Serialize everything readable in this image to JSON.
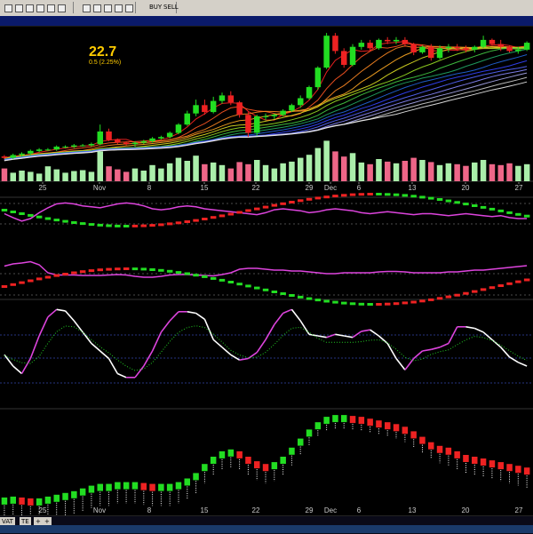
{
  "price": {
    "value": "22.7",
    "change": "0.5 (2.25%)"
  },
  "toolbar": {
    "icons": [
      "grid-icon",
      "pencil-icon",
      "undo-icon",
      "redo-icon",
      "crosshair-icon",
      "trendline-icon",
      "line-tool-icon",
      "zoom-icon",
      "magnet-icon",
      "buy-icon",
      "sell-icon"
    ],
    "buy_label": "BUY",
    "sell_label": "SELL"
  },
  "tabs": [
    "VAT",
    "TE",
    "+",
    "+"
  ],
  "colors": {
    "up": "#22dd22",
    "down": "#ee2222",
    "osc": "#dd44dd",
    "white": "#ffffff",
    "dots": "#22cc22",
    "grid": "#555555"
  },
  "chart_data": [
    {
      "type": "candlestick",
      "panel": "price",
      "x_tick_labels": [
        "25",
        "Nov",
        "8",
        "15",
        "22",
        "29",
        "Dec",
        "6",
        "13",
        "20",
        "27"
      ],
      "candles": [
        [
          14.5,
          14.6,
          14.3,
          14.4
        ],
        [
          14.4,
          14.7,
          14.3,
          14.6
        ],
        [
          14.6,
          14.8,
          14.5,
          14.7
        ],
        [
          14.7,
          15.0,
          14.6,
          14.9
        ],
        [
          14.9,
          15.1,
          14.8,
          15.0
        ],
        [
          15.0,
          15.1,
          14.9,
          15.0
        ],
        [
          15.0,
          15.3,
          14.9,
          15.2
        ],
        [
          15.2,
          15.3,
          15.1,
          15.2
        ],
        [
          15.2,
          15.4,
          15.1,
          15.3
        ],
        [
          15.3,
          15.4,
          15.2,
          15.3
        ],
        [
          15.3,
          15.5,
          15.2,
          15.4
        ],
        [
          15.4,
          16.8,
          15.3,
          16.3
        ],
        [
          16.3,
          16.5,
          15.6,
          15.7
        ],
        [
          15.7,
          15.8,
          15.4,
          15.5
        ],
        [
          15.5,
          15.6,
          15.3,
          15.4
        ],
        [
          15.4,
          15.6,
          15.2,
          15.5
        ],
        [
          15.5,
          15.7,
          15.4,
          15.6
        ],
        [
          15.6,
          15.9,
          15.5,
          15.8
        ],
        [
          15.8,
          16.0,
          15.7,
          15.9
        ],
        [
          15.9,
          16.3,
          15.8,
          16.2
        ],
        [
          16.2,
          16.9,
          16.1,
          16.8
        ],
        [
          16.8,
          17.8,
          16.7,
          17.6
        ],
        [
          17.6,
          18.6,
          17.4,
          18.2
        ],
        [
          18.2,
          18.6,
          17.5,
          17.7
        ],
        [
          17.7,
          18.8,
          17.6,
          18.5
        ],
        [
          18.5,
          19.1,
          18.3,
          18.9
        ],
        [
          18.9,
          19.2,
          18.2,
          18.4
        ],
        [
          18.4,
          18.5,
          17.3,
          17.5
        ],
        [
          17.5,
          17.7,
          15.9,
          16.2
        ],
        [
          16.2,
          17.5,
          16.0,
          17.4
        ],
        [
          17.4,
          17.6,
          17.1,
          17.4
        ],
        [
          17.4,
          17.6,
          17.2,
          17.5
        ],
        [
          17.5,
          17.9,
          17.4,
          17.8
        ],
        [
          17.8,
          18.3,
          17.7,
          18.2
        ],
        [
          18.2,
          18.9,
          18.0,
          18.7
        ],
        [
          18.7,
          19.6,
          18.6,
          19.5
        ],
        [
          19.5,
          21.0,
          19.3,
          20.9
        ],
        [
          20.9,
          23.4,
          20.8,
          23.2
        ],
        [
          23.2,
          23.4,
          21.9,
          22.1
        ],
        [
          22.1,
          22.3,
          20.9,
          21.1
        ],
        [
          21.1,
          22.6,
          21.0,
          22.4
        ],
        [
          22.4,
          22.9,
          22.2,
          22.7
        ],
        [
          22.7,
          22.9,
          22.1,
          22.3
        ],
        [
          22.3,
          23.0,
          22.2,
          22.9
        ],
        [
          22.9,
          23.1,
          22.6,
          22.8
        ],
        [
          22.8,
          23.1,
          22.6,
          22.9
        ],
        [
          22.9,
          23.1,
          22.4,
          22.6
        ],
        [
          22.6,
          22.7,
          21.8,
          22.0
        ],
        [
          22.0,
          22.5,
          21.9,
          22.4
        ],
        [
          22.4,
          22.6,
          21.4,
          21.6
        ],
        [
          21.6,
          22.5,
          21.5,
          22.3
        ],
        [
          22.3,
          22.6,
          22.0,
          22.4
        ],
        [
          22.4,
          22.6,
          22.1,
          22.3
        ],
        [
          22.3,
          22.5,
          22.0,
          22.2
        ],
        [
          22.2,
          22.5,
          22.0,
          22.4
        ],
        [
          22.4,
          23.2,
          22.3,
          22.9
        ],
        [
          22.9,
          23.0,
          22.5,
          22.6
        ],
        [
          22.6,
          22.9,
          22.1,
          22.4
        ],
        [
          22.4,
          22.5,
          22.0,
          22.1
        ],
        [
          22.1,
          22.4,
          21.9,
          22.2
        ],
        [
          22.2,
          22.8,
          22.1,
          22.7
        ]
      ],
      "volumes": [
        30,
        20,
        25,
        22,
        18,
        35,
        28,
        20,
        24,
        26,
        22,
        70,
        35,
        28,
        22,
        30,
        25,
        38,
        30,
        42,
        55,
        48,
        60,
        40,
        44,
        38,
        30,
        45,
        40,
        50,
        38,
        30,
        42,
        46,
        55,
        62,
        78,
        95,
        70,
        58,
        66,
        44,
        40,
        52,
        46,
        42,
        48,
        55,
        50,
        45,
        38,
        42,
        40,
        36,
        44,
        50,
        40,
        38,
        42,
        36,
        40
      ]
    },
    {
      "type": "line",
      "panel": "oscillator-1",
      "series": [
        {
          "values": [
            0.7,
            0.62,
            0.55,
            0.6,
            0.72,
            0.82,
            0.9,
            0.92,
            0.9,
            0.86,
            0.84,
            0.82,
            0.86,
            0.9,
            0.92,
            0.9,
            0.86,
            0.8,
            0.78,
            0.8,
            0.84,
            0.86,
            0.84,
            0.8,
            0.78,
            0.76,
            0.74,
            0.72,
            0.7,
            0.68,
            0.72,
            0.78,
            0.8,
            0.78,
            0.76,
            0.72,
            0.74,
            0.78,
            0.8,
            0.78,
            0.76,
            0.72,
            0.7,
            0.72,
            0.74,
            0.72,
            0.7,
            0.68,
            0.7,
            0.7,
            0.68,
            0.66,
            0.68,
            0.7,
            0.68,
            0.66,
            0.64,
            0.66,
            0.62,
            0.6,
            0.6
          ]
        }
      ]
    },
    {
      "type": "line",
      "panel": "oscillator-1b",
      "series": [
        {
          "values": [
            0.75,
            0.8,
            0.82,
            0.85,
            0.78,
            0.6,
            0.55,
            0.55,
            0.55,
            0.54,
            0.54,
            0.54,
            0.55,
            0.56,
            0.55,
            0.52,
            0.5,
            0.5,
            0.52,
            0.55,
            0.56,
            0.56,
            0.55,
            0.54,
            0.53,
            0.56,
            0.6,
            0.68,
            0.7,
            0.7,
            0.68,
            0.66,
            0.66,
            0.64,
            0.64,
            0.62,
            0.6,
            0.58,
            0.58,
            0.6,
            0.6,
            0.6,
            0.6,
            0.62,
            0.63,
            0.63,
            0.62,
            0.6,
            0.6,
            0.6,
            0.6,
            0.62,
            0.62,
            0.64,
            0.66,
            0.66,
            0.68,
            0.7,
            0.72,
            0.74,
            0.76
          ]
        }
      ]
    },
    {
      "type": "line",
      "panel": "oscillator-2",
      "series": [
        {
          "values": [
            0.35,
            0.2,
            0.1,
            0.3,
            0.6,
            0.85,
            0.95,
            0.93,
            0.8,
            0.65,
            0.5,
            0.4,
            0.3,
            0.1,
            0.05,
            0.05,
            0.2,
            0.4,
            0.65,
            0.8,
            0.92,
            0.92,
            0.9,
            0.82,
            0.55,
            0.45,
            0.35,
            0.28,
            0.3,
            0.38,
            0.55,
            0.75,
            0.9,
            0.95,
            0.8,
            0.62,
            0.6,
            0.58,
            0.62,
            0.6,
            0.58,
            0.66,
            0.68,
            0.6,
            0.5,
            0.3,
            0.15,
            0.3,
            0.4,
            0.42,
            0.45,
            0.5,
            0.72,
            0.72,
            0.7,
            0.65,
            0.55,
            0.45,
            0.32,
            0.25,
            0.2
          ]
        }
      ]
    }
  ]
}
